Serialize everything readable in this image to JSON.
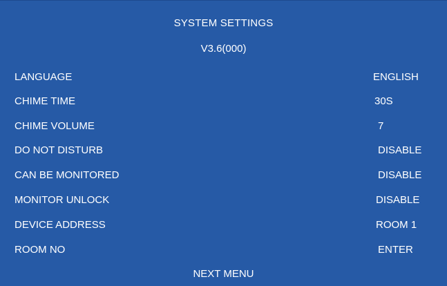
{
  "screen": {
    "title": "SYSTEM SETTINGS",
    "version": "V3.6(000)",
    "background_color": "#265aa6",
    "text_color": "#ffffff"
  },
  "settings": [
    {
      "label": "LANGUAGE",
      "value": "ENGLISH"
    },
    {
      "label": "CHIME TIME",
      "value": "30S"
    },
    {
      "label": "CHIME VOLUME",
      "value": "7"
    },
    {
      "label": "DO NOT DISTURB",
      "value": "DISABLE"
    },
    {
      "label": "CAN BE MONITORED",
      "value": "DISABLE"
    },
    {
      "label": "MONITOR UNLOCK",
      "value": "DISABLE"
    },
    {
      "label": "DEVICE ADDRESS",
      "value": "ROOM 1"
    },
    {
      "label": "ROOM NO",
      "value": "ENTER"
    }
  ],
  "footer": {
    "next_menu_label": "NEXT MENU"
  }
}
